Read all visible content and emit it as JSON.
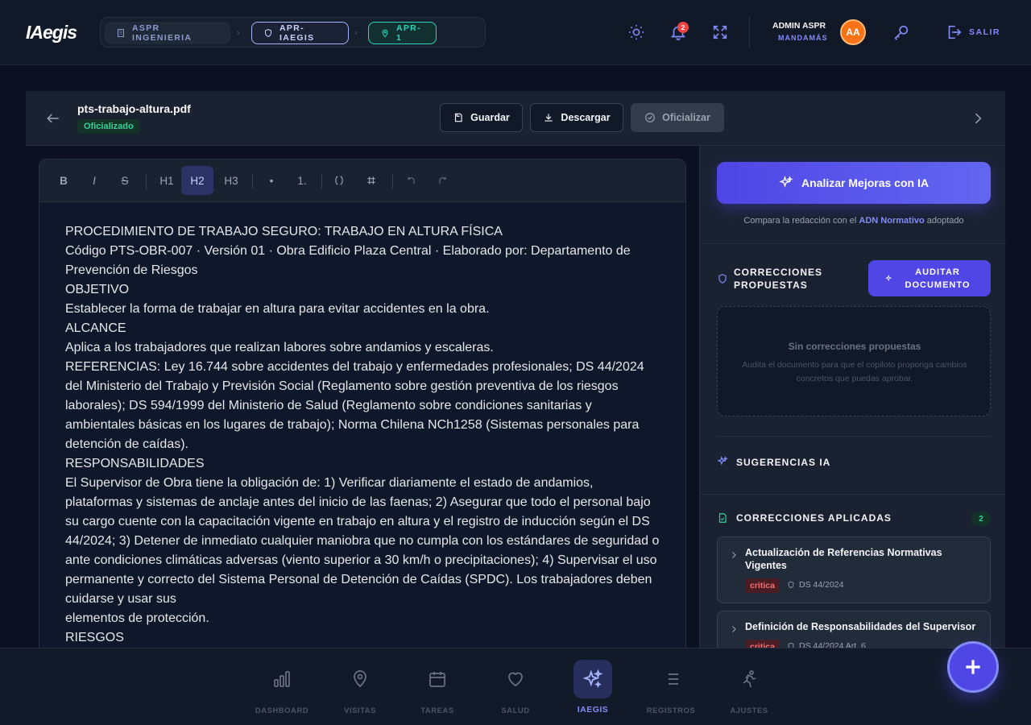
{
  "app": {
    "logo": "IAegis"
  },
  "breadcrumb": [
    {
      "label": "ASPR INGENIERIA",
      "icon": "building-icon"
    },
    {
      "label": "APR-IAEGIS",
      "icon": "shield-icon"
    },
    {
      "label": "APR-1",
      "icon": "map-pin-icon"
    }
  ],
  "topbar": {
    "notifications_count": "2",
    "user_name": "ADMIN ASPR",
    "user_role": "MANDAMÁS",
    "avatar_initials": "AA",
    "logout_label": "SALIR"
  },
  "document": {
    "filename": "pts-trabajo-altura.pdf",
    "status": "Oficializado",
    "buttons": {
      "save": "Guardar",
      "download": "Descargar",
      "officialize": "Oficializar"
    }
  },
  "editor": {
    "toolbar": [
      "B",
      "I",
      "S",
      "H1",
      "H2",
      "H3",
      "•",
      "1."
    ],
    "active_tool": "H2",
    "paragraphs": [
      "PROCEDIMIENTO DE TRABAJO SEGURO: TRABAJO EN ALTURA FÍSICA",
      "Código PTS-OBR-007 · Versión 01 · Obra Edificio Plaza Central · Elaborado por: Departamento de Prevención de Riesgos",
      "OBJETIVO",
      "Establecer la forma de trabajar en altura para evitar accidentes en la obra.",
      "ALCANCE",
      "Aplica a los trabajadores que realizan labores sobre andamios y escaleras.",
      "REFERENCIAS: Ley 16.744 sobre accidentes del trabajo y enfermedades profesionales; DS 44/2024 del Ministerio del Trabajo y Previsión Social (Reglamento sobre gestión preventiva de los riesgos laborales); DS 594/1999 del Ministerio de Salud (Reglamento sobre condiciones sanitarias y ambientales básicas en los lugares de trabajo); Norma Chilena NCh1258 (Sistemas personales para detención de caídas).",
      "RESPONSABILIDADES",
      "El Supervisor de Obra tiene la obligación de: 1) Verificar diariamente el estado de andamios, plataformas y sistemas de anclaje antes del inicio de las faenas; 2) Asegurar que todo el personal bajo su cargo cuente con la capacitación vigente en trabajo en altura y el registro de inducción según el DS 44/2024; 3) Detener de inmediato cualquier maniobra que no cumpla con los estándares de seguridad o ante condiciones climáticas adversas (viento superior a 30 km/h o precipitaciones); 4) Supervisar el uso permanente y correcto del Sistema Personal de Detención de Caídas (SPDC). Los trabajadores deben cuidarse y usar sus",
      "elementos de protección.",
      "RIESGOS"
    ]
  },
  "panel": {
    "ai_button": "Analizar Mejoras con IA",
    "ai_subtitle_pre": "Compara la redacción con el ",
    "ai_subtitle_link": "ADN Normativo",
    "ai_subtitle_post": " adoptado",
    "corrections_title": "CORRECCIONES PROPUESTAS",
    "audit_button": "AUDITAR DOCUMENTO",
    "empty_title": "Sin correcciones propuestas",
    "empty_text": "Audita el documento para que el copiloto proponga cambios concretos que puedas aprobar.",
    "suggestions_title": "SUGERENCIAS IA",
    "applied_title": "CORRECCIONES APLICADAS",
    "applied_count": "2",
    "applied": [
      {
        "title": "Actualización de Referencias Normativas Vigentes",
        "severity": "critica",
        "ref": "DS 44/2024"
      },
      {
        "title": "Definición de Responsabilidades del Supervisor",
        "severity": "critica",
        "ref": "DS 44/2024 Art. 6"
      }
    ]
  },
  "nav": [
    {
      "label": "DASHBOARD",
      "icon": "bar-chart-icon"
    },
    {
      "label": "VISITAS",
      "icon": "map-pin-icon"
    },
    {
      "label": "TAREAS",
      "icon": "calendar-icon"
    },
    {
      "label": "SALUD",
      "icon": "heart-icon"
    },
    {
      "label": "IAEGIS",
      "icon": "sparkles-icon",
      "active": true
    },
    {
      "label": "REGISTROS",
      "icon": "list-icon"
    },
    {
      "label": "AJUSTES",
      "icon": "running-figure-icon"
    }
  ],
  "fab": {
    "label": "+"
  },
  "colors": {
    "accent": "#4f46e5",
    "success": "#34d399",
    "danger": "#ef4444",
    "teal": "#2dd4bf"
  }
}
